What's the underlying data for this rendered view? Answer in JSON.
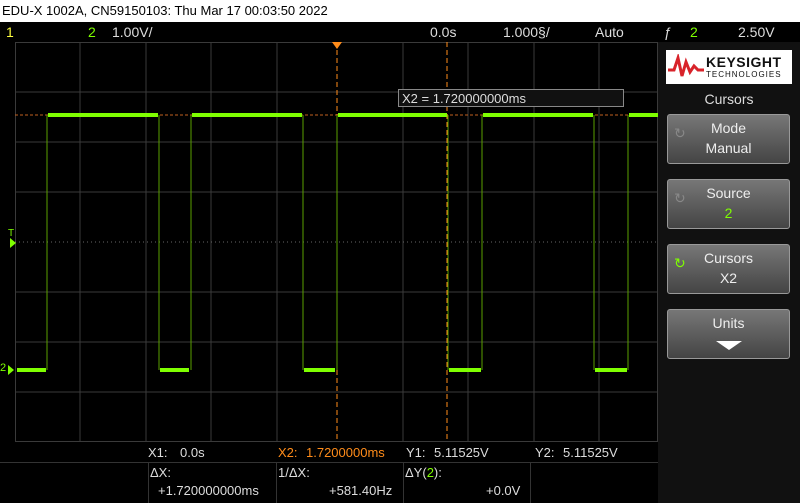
{
  "title_bar": "EDU-X 1002A, CN59150103: Thu Mar 17 00:03:50 2022",
  "status": {
    "ch1_number": "1",
    "ch2_number": "2",
    "ch2_scale": "1.00V/",
    "time_position": "0.0s",
    "time_scale": "1.000§/",
    "trigger_mode": "Auto",
    "trigger_slope_symbol": "ƒ",
    "trigger_channel": "2",
    "trigger_level": "2.50V"
  },
  "screen": {
    "trigger_marker_label": "T",
    "ground_marker_label": "2",
    "cursor_x2_label": "X2 = 1.720000000ms"
  },
  "side_panel": {
    "brand_name": "KEYSIGHT",
    "brand_sub": "TECHNOLOGIES",
    "menu_title": "Cursors",
    "softkeys": [
      {
        "label": "Mode",
        "value": "Manual"
      },
      {
        "label": "Source",
        "value": "2"
      },
      {
        "label": "Cursors",
        "value": "X2"
      },
      {
        "label": "Units",
        "value": ""
      }
    ]
  },
  "readouts": {
    "x1_label": "X1:",
    "x1_value": "0.0s",
    "x2_label": "X2:",
    "x2_value": "1.7200000ms",
    "y1_label": "Y1:",
    "y1_value": "5.11525V",
    "y2_label": "Y2:",
    "y2_value": "5.11525V",
    "dx_label": "ΔX:",
    "dx_value": "+1.720000000ms",
    "inv_dx_label": "1/ΔX:",
    "inv_dx_value": "+581.40Hz",
    "dy_label_prefix": "ΔY(",
    "dy_channel": "2",
    "dy_label_suffix": "):",
    "dy_value": "+0.0V"
  },
  "colors": {
    "channel2": "#7fff00",
    "channel1": "#ffff40",
    "cursor": "#ff8c1a",
    "grid": "#444444"
  }
}
